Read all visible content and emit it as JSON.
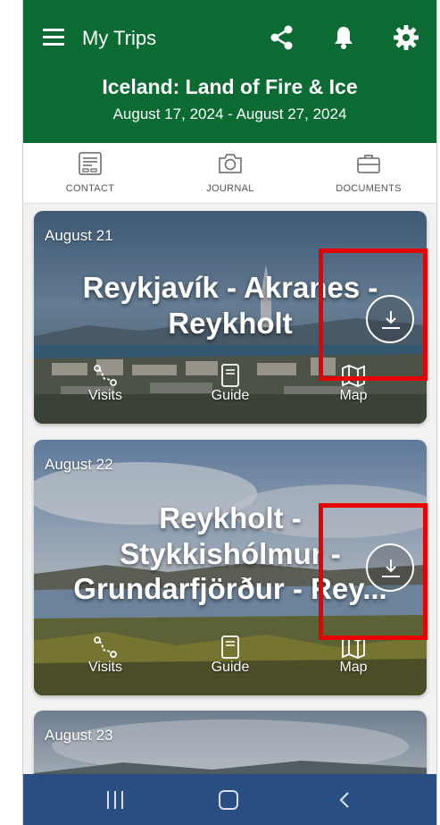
{
  "header": {
    "app_title": "My Trips",
    "trip_title": "Iceland: Land of Fire & Ice",
    "trip_dates": "August 17, 2024 - August 27, 2024",
    "icons": [
      "menu-icon",
      "share-icon",
      "bell-icon",
      "gear-icon"
    ]
  },
  "tabs": [
    {
      "label": "CONTACT",
      "icon": "contact-card-icon"
    },
    {
      "label": "JOURNAL",
      "icon": "camera-icon"
    },
    {
      "label": "DOCUMENTS",
      "icon": "briefcase-icon"
    }
  ],
  "days": [
    {
      "date": "August 21",
      "title_line1": "Reykjavík - Akranes -",
      "title_line2": "Reykholt",
      "actions": {
        "visits": "Visits",
        "guide": "Guide",
        "map": "Map"
      }
    },
    {
      "date": "August 22",
      "title_line1": "Reykholt -",
      "title_line2": "Stykkishólmur -",
      "title_line3": "Grundarfjörður - Rey...",
      "actions": {
        "visits": "Visits",
        "guide": "Guide",
        "map": "Map"
      }
    },
    {
      "date": "August 23"
    }
  ],
  "colors": {
    "header_green": "#0b6b32",
    "navbar_blue": "#294e82",
    "highlight_red": "#e60000"
  },
  "navbar": {
    "icons": [
      "recent-apps-icon",
      "home-icon",
      "back-icon"
    ]
  }
}
